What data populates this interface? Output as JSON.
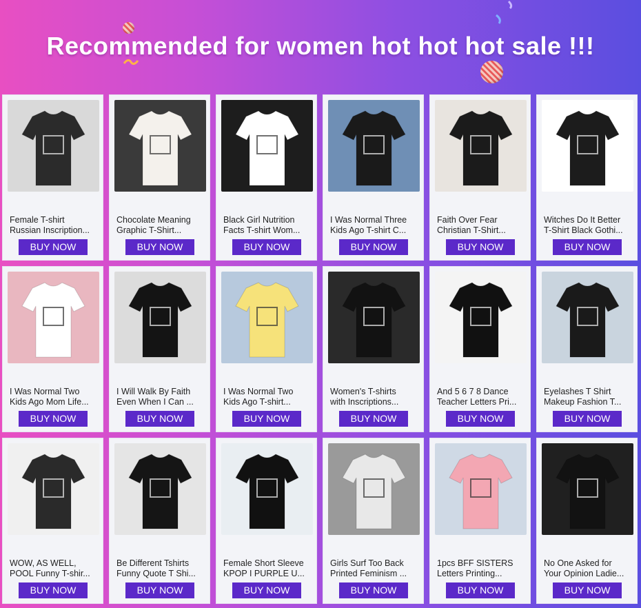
{
  "banner": {
    "title": "Recommended for women hot hot hot sale !!!",
    "colors": {
      "gradient_left": "#e84fc2",
      "gradient_right": "#5a4ee0",
      "button": "#5b29c9"
    }
  },
  "products": [
    {
      "line1": "Female T-shirt",
      "line2": "Russian Inscription...",
      "button": "BUY NOW",
      "image_icon": "tshirt-photo-icon"
    },
    {
      "line1": "Chocolate Meaning",
      "line2": "Graphic T-Shirt...",
      "button": "BUY NOW",
      "image_icon": "tshirt-photo-icon"
    },
    {
      "line1": "Black Girl Nutrition",
      "line2": "Facts T-shirt Wom...",
      "button": "BUY NOW",
      "image_icon": "tshirt-photo-icon"
    },
    {
      "line1": "I Was Normal Three",
      "line2": "Kids Ago T-shirt C...",
      "button": "BUY NOW",
      "image_icon": "tshirt-photo-icon"
    },
    {
      "line1": "Faith Over Fear",
      "line2": "Christian T-Shirt...",
      "button": "BUY NOW",
      "image_icon": "tshirt-photo-icon"
    },
    {
      "line1": "Witches Do It Better",
      "line2": "T-Shirt Black Gothi...",
      "button": "BUY NOW",
      "image_icon": "tshirt-photo-icon"
    },
    {
      "line1": "I Was Normal Two",
      "line2": "Kids Ago Mom Life...",
      "button": "BUY NOW",
      "image_icon": "tshirt-photo-icon"
    },
    {
      "line1": "I Will Walk By Faith",
      "line2": "Even When I Can ...",
      "button": "BUY NOW",
      "image_icon": "tshirt-photo-icon"
    },
    {
      "line1": "I Was Normal Two",
      "line2": "Kids Ago T-shirt...",
      "button": "BUY NOW",
      "image_icon": "tshirt-photo-icon"
    },
    {
      "line1": "Women's T-shirts",
      "line2": "with Inscriptions...",
      "button": "BUY NOW",
      "image_icon": "tshirt-photo-icon"
    },
    {
      "line1": "And 5 6 7 8 Dance",
      "line2": "Teacher Letters Pri...",
      "button": "BUY NOW",
      "image_icon": "tshirt-photo-icon"
    },
    {
      "line1": "Eyelashes T Shirt",
      "line2": "Makeup Fashion T...",
      "button": "BUY NOW",
      "image_icon": "tshirt-photo-icon"
    },
    {
      "line1": "WOW, AS WELL,",
      "line2": "POOL Funny T-shir...",
      "button": "BUY NOW",
      "image_icon": "tshirt-photo-icon"
    },
    {
      "line1": "Be Different Tshirts",
      "line2": "Funny Quote T Shi...",
      "button": "BUY NOW",
      "image_icon": "tshirt-photo-icon"
    },
    {
      "line1": "Female Short Sleeve",
      "line2": "KPOP I PURPLE U...",
      "button": "BUY NOW",
      "image_icon": "tshirt-photo-icon"
    },
    {
      "line1": "Girls Surf Too Back",
      "line2": "Printed Feminism ...",
      "button": "BUY NOW",
      "image_icon": "tshirt-photo-icon"
    },
    {
      "line1": "1pcs BFF SISTERS",
      "line2": "Letters Printing...",
      "button": "BUY NOW",
      "image_icon": "tshirt-photo-icon"
    },
    {
      "line1": "No One Asked for",
      "line2": "Your Opinion Ladie...",
      "button": "BUY NOW",
      "image_icon": "tshirt-photo-icon"
    }
  ]
}
